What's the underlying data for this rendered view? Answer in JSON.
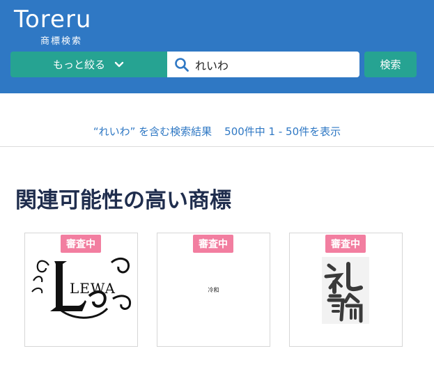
{
  "header": {
    "logo_text": "Toreru",
    "logo_subtitle": "商標検索",
    "refine_label": "もっと絞る",
    "search": {
      "value": "れいわ",
      "placeholder": ""
    },
    "search_button_label": "検索",
    "colors": {
      "header_bg": "#2f78c4",
      "button_bg": "#26a392"
    }
  },
  "results": {
    "query_text": "“れいわ” を含む検索結果",
    "count_text": "500件中 1 - 50件を表示"
  },
  "section": {
    "title": "関連可能性の高い商標"
  },
  "cards": [
    {
      "badge": "審査中",
      "mark": "LEWA"
    },
    {
      "badge": "審査中",
      "mark": "冷和"
    },
    {
      "badge": "審査中",
      "mark": "礼輪"
    }
  ],
  "icons": [
    "chevron-down-icon",
    "search-icon"
  ]
}
